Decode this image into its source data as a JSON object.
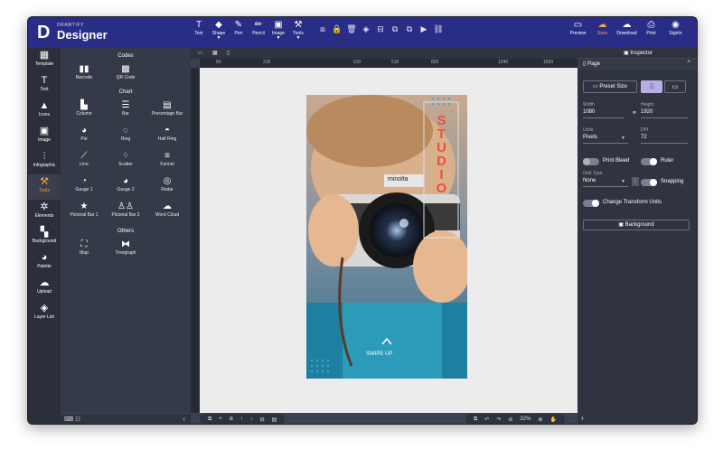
{
  "topbar": {
    "brand_small": "DRAWTIFY",
    "brand": "Designer",
    "tools": [
      {
        "icon": "T",
        "label": "Text"
      },
      {
        "icon": "◆",
        "label": "Shape"
      },
      {
        "icon": "✎",
        "label": "Pen"
      },
      {
        "icon": "✏",
        "label": "Pencil"
      },
      {
        "icon": "▣",
        "label": "Image"
      },
      {
        "icon": "⚒",
        "label": "Tools"
      }
    ],
    "actions": [
      "⧈",
      "🔒",
      "🗑",
      "◈",
      "⊟",
      "⧉",
      "⧉",
      "▶",
      "⛓"
    ],
    "right": [
      {
        "icon": "▭",
        "label": "Preview"
      },
      {
        "icon": "☁",
        "label": "Save"
      },
      {
        "icon": "☁",
        "label": "Download"
      },
      {
        "icon": "⎙",
        "label": "Print"
      },
      {
        "icon": "◉",
        "label": "SignIn"
      }
    ]
  },
  "leftbar": [
    {
      "icon": "▦",
      "label": "Template"
    },
    {
      "icon": "T",
      "label": "Text"
    },
    {
      "icon": "▲",
      "label": "Icons"
    },
    {
      "icon": "▣",
      "label": "Image"
    },
    {
      "icon": "⫶",
      "label": "Infographic"
    },
    {
      "icon": "⚒",
      "label": "Tools"
    },
    {
      "icon": "✲",
      "label": "Elements"
    },
    {
      "icon": "▚",
      "label": "Background"
    },
    {
      "icon": "◕",
      "label": "Palette"
    },
    {
      "icon": "☁",
      "label": "Upload"
    },
    {
      "icon": "◈",
      "label": "Layer List"
    }
  ],
  "panel": {
    "codes_title": "Codes",
    "codes": [
      {
        "icon": "▮▮",
        "label": "Barcode"
      },
      {
        "icon": "▩",
        "label": "QR Code"
      }
    ],
    "chart_title": "Chart",
    "chart": [
      {
        "icon": "▙",
        "label": "Column"
      },
      {
        "icon": "☰",
        "label": "Bar"
      },
      {
        "icon": "▤",
        "label": "Precentage Bar"
      },
      {
        "icon": "◕",
        "label": "Pie"
      },
      {
        "icon": "◌",
        "label": "Ring"
      },
      {
        "icon": "◓",
        "label": "Half Ring"
      },
      {
        "icon": "⟋",
        "label": "Line"
      },
      {
        "icon": "⁘",
        "label": "Scatter"
      },
      {
        "icon": "≡",
        "label": "Funnel"
      },
      {
        "icon": "◔",
        "label": "Gauge 1"
      },
      {
        "icon": "◕",
        "label": "Gauge 2"
      },
      {
        "icon": "◎",
        "label": "Radar"
      },
      {
        "icon": "★",
        "label": "Pictorial Bar 1"
      },
      {
        "icon": "♙♙",
        "label": "Pictorial Bar 2"
      },
      {
        "icon": "☁",
        "label": "Word Cloud"
      }
    ],
    "others_title": "Others",
    "others": [
      {
        "icon": "⛶",
        "label": "Map"
      },
      {
        "icon": "⧓",
        "label": "Treegraph"
      }
    ]
  },
  "ruler": [
    "50",
    "510",
    "820",
    "1240",
    "1550",
    "210",
    "510"
  ],
  "artboard": {
    "studio_text": "STUDIO",
    "camera_text": "minolta",
    "swipe_text": "SWIPE UP"
  },
  "canvas_bottom": {
    "left_icons": [
      "⧉",
      "+",
      "⧈",
      "↑",
      "↓",
      "⊟",
      "▤"
    ],
    "zoom": "32%"
  },
  "inspector": {
    "title": "Inspector",
    "page_label": "Page",
    "preset_label": "Preset Size",
    "width_label": "Width",
    "width_value": "1080",
    "height_label": "Height",
    "height_value": "1920",
    "units_label": "Units",
    "units_value": "Pixels",
    "dpi_label": "DPI",
    "dpi_value": "72",
    "print_bleed": "Print Bleed",
    "ruler": "Ruler",
    "grid_type_label": "Grid Type",
    "grid_type_value": "None",
    "snapping": "Snapping",
    "change_units": "Change Transform Units",
    "background": "Background"
  },
  "colors": {
    "topbar": "#2a2d86",
    "accent": "#f4a340",
    "panel": "#353a48",
    "stage": "#ececec"
  }
}
